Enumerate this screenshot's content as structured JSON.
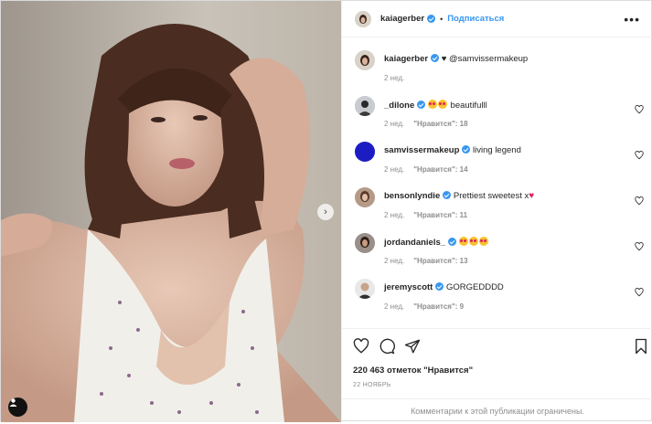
{
  "post": {
    "username": "kaiagerber",
    "follow_label": "Подписаться",
    "more_label": "•••",
    "next_arrow": "›"
  },
  "caption": {
    "username": "kaiagerber",
    "text": "♥ @samvissermakeup",
    "time": "2 нед."
  },
  "comments": [
    {
      "username": "_dilone",
      "verified": true,
      "text": "beautifulll",
      "emoji_count": 2,
      "time": "2 нед.",
      "likes": "\"Нравится\": 18"
    },
    {
      "username": "samvissermakeup",
      "verified": true,
      "text": "living legend",
      "emoji_count": 0,
      "time": "2 нед.",
      "likes": "\"Нравится\": 14"
    },
    {
      "username": "bensonlyndie",
      "verified": true,
      "text": "Prettiest sweetest x",
      "emoji_count": 0,
      "time": "2 нед.",
      "likes": "\"Нравится\": 11"
    },
    {
      "username": "jordandaniels_",
      "verified": true,
      "text": "",
      "emoji_count": 3,
      "time": "2 нед.",
      "likes": "\"Нравится\": 13"
    },
    {
      "username": "jeremyscott",
      "verified": true,
      "text": "GORGEDDDD",
      "emoji_count": 0,
      "time": "2 нед.",
      "likes": "\"Нравится\": 9"
    }
  ],
  "footer": {
    "likes_count": "220 463 отметок \"Нравится\"",
    "date": "22 НОЯБРЬ",
    "comments_closed": "Комментарии к этой публикации ограничены."
  },
  "icons": {
    "like": "heart-icon",
    "comment": "comment-icon",
    "share": "share-icon",
    "save": "bookmark-icon",
    "tag": "person-tag-icon"
  },
  "colors": {
    "accent": "#3897f0",
    "muted": "#8e8e8e",
    "heart": "#e0245e"
  }
}
